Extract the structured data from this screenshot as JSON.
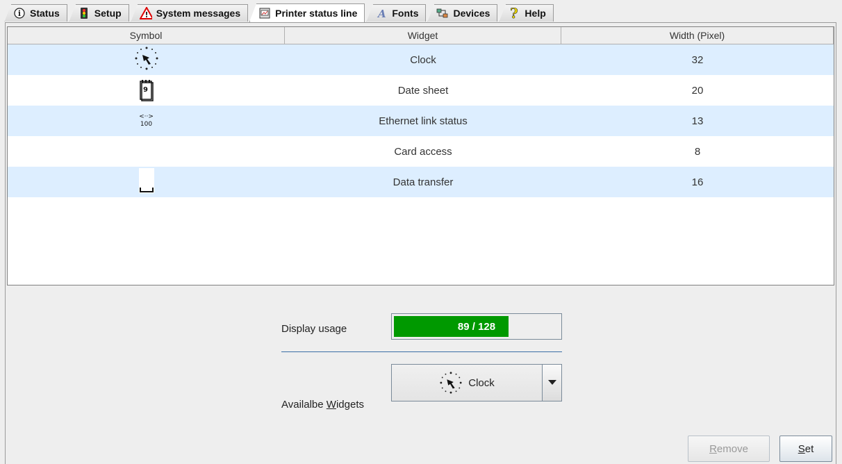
{
  "tabs": [
    {
      "label": "Status",
      "icon": "info-icon"
    },
    {
      "label": "Setup",
      "icon": "traffic-light-icon"
    },
    {
      "label": "System messages",
      "icon": "warning-icon"
    },
    {
      "label": "Printer status line",
      "icon": "printer-status-icon",
      "active": true
    },
    {
      "label": "Fonts",
      "icon": "font-icon"
    },
    {
      "label": "Devices",
      "icon": "devices-icon"
    },
    {
      "label": "Help",
      "icon": "help-icon"
    }
  ],
  "table": {
    "headers": [
      "Symbol",
      "Widget",
      "Width (Pixel)"
    ],
    "rows": [
      {
        "symbol": "clock-icon",
        "widget": "Clock",
        "width": "32"
      },
      {
        "symbol": "date-sheet-icon",
        "widget": "Date sheet",
        "width": "20",
        "symbol_text": "9"
      },
      {
        "symbol": "ethernet-icon",
        "widget": "Ethernet link status",
        "width": "13",
        "symbol_text": "<··>",
        "symbol_sub": "100"
      },
      {
        "symbol": "",
        "widget": "Card access",
        "width": "8"
      },
      {
        "symbol": "data-transfer-icon",
        "widget": "Data transfer",
        "width": "16"
      }
    ]
  },
  "usage": {
    "label": "Display usage",
    "text": "89 / 128",
    "value": 89,
    "max": 128,
    "color": "#009900"
  },
  "widgets": {
    "label_prefix": "Availalbe ",
    "label_mnemonic": "W",
    "label_suffix": "idgets",
    "selected": "Clock",
    "selected_icon": "clock-icon"
  },
  "buttons": {
    "remove_mnemonic": "R",
    "remove_rest": "emove",
    "set_mnemonic": "S",
    "set_rest": "et"
  }
}
